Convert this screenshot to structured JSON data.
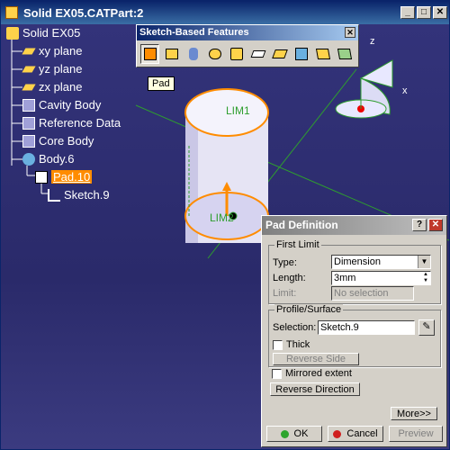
{
  "window": {
    "title": "Solid EX05.CATPart:2",
    "min": "_",
    "max": "□",
    "close": "✕"
  },
  "tree": {
    "root": "Solid EX05",
    "items": [
      {
        "label": "xy plane"
      },
      {
        "label": "yz plane"
      },
      {
        "label": "zx plane"
      },
      {
        "label": "Cavity Body"
      },
      {
        "label": "Reference Data"
      },
      {
        "label": "Core Body"
      },
      {
        "label": "Body.6"
      },
      {
        "label": "Pad.10"
      },
      {
        "label": "Sketch.9"
      }
    ]
  },
  "toolbar": {
    "title": "Sketch-Based Features",
    "close": "✕",
    "tooltip": "Pad"
  },
  "viewport": {
    "lim1": "LIM1",
    "lim2": "LIM2",
    "axis_z": "z",
    "axis_x": "x"
  },
  "dialog": {
    "title": "Pad Definition",
    "help": "?",
    "close": "✕",
    "first_limit": {
      "label": "First Limit",
      "type_label": "Type:",
      "type_value": "Dimension",
      "length_label": "Length:",
      "length_value": "3mm",
      "limit_label": "Limit:",
      "limit_value": "No selection"
    },
    "profile": {
      "label": "Profile/Surface",
      "selection_label": "Selection:",
      "selection_value": "Sketch.9",
      "thick_label": "Thick",
      "reverse_side": "Reverse Side"
    },
    "mirrored_label": "Mirrored extent",
    "reverse_direction": "Reverse Direction",
    "more": "More>>",
    "ok": "OK",
    "cancel": "Cancel",
    "preview": "Preview"
  },
  "colors": {
    "accent": "#ff8c00",
    "canvas": "#2c2c6e",
    "titlebar": "#0a246a"
  }
}
